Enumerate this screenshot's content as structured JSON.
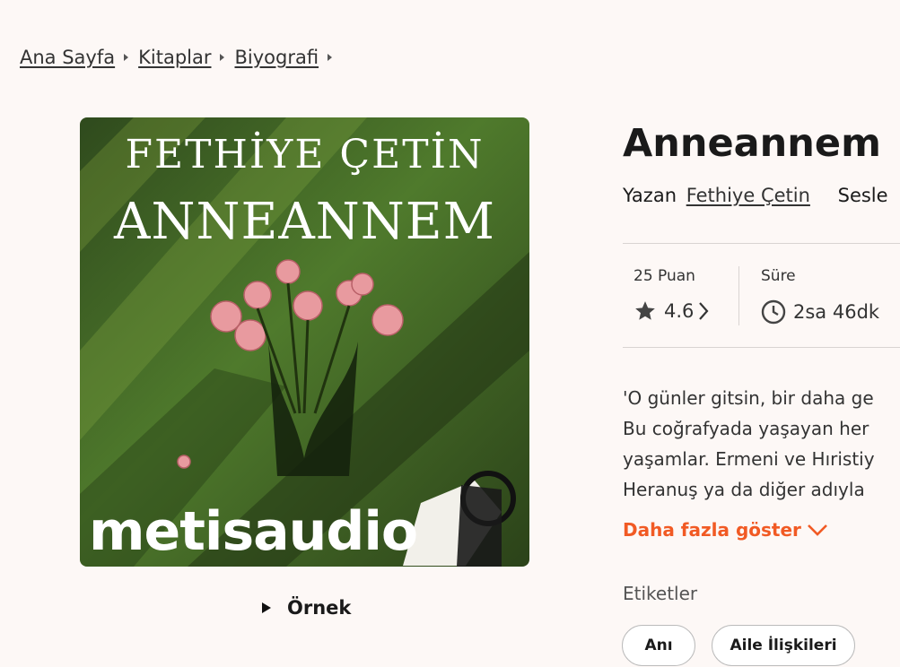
{
  "breadcrumb": [
    "Ana Sayfa",
    "Kitaplar",
    "Biyografi"
  ],
  "cover": {
    "author_text": "FETHİYE ÇETİN",
    "title_text": "ANNEANNEM",
    "publisher_logo": "metisaudio"
  },
  "sample_label": "Örnek",
  "book": {
    "title": "Anneannem",
    "by_label": "Yazan",
    "author": "Fethiye Çetin",
    "narrator_prefix": "Sesle"
  },
  "stats": {
    "rating_label": "25 Puan",
    "rating_value": "4.6",
    "duration_label": "Süre",
    "duration_value": "2sa 46dk"
  },
  "description_lines": [
    "'O günler gitsin, bir daha ge",
    "Bu coğrafyada yaşayan her",
    "yaşamlar. Ermeni ve Hıristiy",
    "Heranuş ya da diğer adıyla"
  ],
  "show_more": "Daha fazla göster",
  "tags_label": "Etiketler",
  "tags": [
    "Anı",
    "Aile İlişkileri"
  ],
  "colors": {
    "accent": "#f15a24",
    "background": "#fdf8f6"
  },
  "icons": [
    "star-icon",
    "chevron-right-icon",
    "clock-icon",
    "chevron-down-icon",
    "play-icon"
  ]
}
